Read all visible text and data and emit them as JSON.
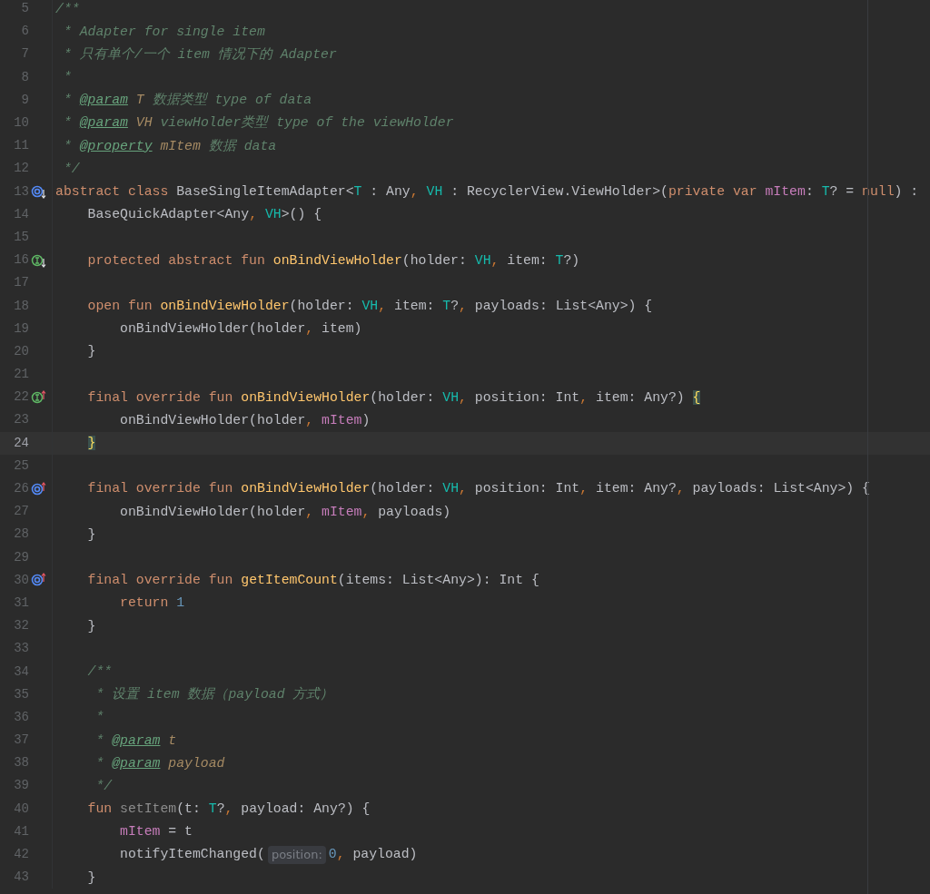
{
  "editor": {
    "lines": [
      {
        "no": "5",
        "current": false,
        "tokens": [
          {
            "text": "/**",
            "kind": "d"
          }
        ]
      },
      {
        "no": "6",
        "current": false,
        "tokens": [
          {
            "text": " * Adapter for single item",
            "kind": "d"
          }
        ]
      },
      {
        "no": "7",
        "current": false,
        "tokens": [
          {
            "text": " * 只有单个/一个 item 情况下的 Adapter",
            "kind": "d"
          }
        ]
      },
      {
        "no": "8",
        "current": false,
        "tokens": [
          {
            "text": " *",
            "kind": "d"
          }
        ]
      },
      {
        "no": "9",
        "current": false,
        "tokens": [
          {
            "text": " * ",
            "kind": "d"
          },
          {
            "text": "@param",
            "kind": "dt"
          },
          {
            "text": " T",
            "kind": "dp"
          },
          {
            "text": " 数据类型 type of data",
            "kind": "d"
          }
        ]
      },
      {
        "no": "10",
        "current": false,
        "tokens": [
          {
            "text": " * ",
            "kind": "d"
          },
          {
            "text": "@param",
            "kind": "dt"
          },
          {
            "text": " VH",
            "kind": "dp"
          },
          {
            "text": " viewHolder类型 type of the viewHolder",
            "kind": "d"
          }
        ]
      },
      {
        "no": "11",
        "current": false,
        "tokens": [
          {
            "text": " * ",
            "kind": "d"
          },
          {
            "text": "@property",
            "kind": "dt"
          },
          {
            "text": " mItem",
            "kind": "dp"
          },
          {
            "text": " 数据 data",
            "kind": "d"
          }
        ]
      },
      {
        "no": "12",
        "current": false,
        "tokens": [
          {
            "text": " */",
            "kind": "d"
          }
        ]
      },
      {
        "no": "13",
        "current": false,
        "gutter": {
          "kind": "ring-down"
        },
        "tokens": [
          {
            "text": "abstract class ",
            "kind": "k"
          },
          {
            "text": "BaseSingleItemAdapter<",
            "kind": "p"
          },
          {
            "text": "T",
            "kind": "ty"
          },
          {
            "text": " : Any",
            "kind": "p"
          },
          {
            "text": ", ",
            "kind": "c"
          },
          {
            "text": "VH",
            "kind": "ty"
          },
          {
            "text": " : RecyclerView.ViewHolder>(",
            "kind": "p"
          },
          {
            "text": "private var ",
            "kind": "k"
          },
          {
            "text": "mItem",
            "kind": "pr"
          },
          {
            "text": ": ",
            "kind": "p"
          },
          {
            "text": "T",
            "kind": "ty"
          },
          {
            "text": "? = ",
            "kind": "p"
          },
          {
            "text": "null",
            "kind": "k"
          },
          {
            "text": ") :",
            "kind": "p"
          }
        ]
      },
      {
        "no": "14",
        "current": false,
        "tokens": [
          {
            "text": "    BaseQuickAdapter<Any",
            "kind": "p"
          },
          {
            "text": ", ",
            "kind": "c"
          },
          {
            "text": "VH",
            "kind": "ty"
          },
          {
            "text": ">() {",
            "kind": "p"
          }
        ]
      },
      {
        "no": "15",
        "current": false
      },
      {
        "no": "16",
        "current": false,
        "gutter": {
          "kind": "i-down"
        },
        "tokens": [
          {
            "text": "    protected abstract fun ",
            "kind": "k"
          },
          {
            "text": "onBindViewHolder",
            "kind": "f"
          },
          {
            "text": "(holder: ",
            "kind": "p"
          },
          {
            "text": "VH",
            "kind": "ty"
          },
          {
            "text": ",",
            "kind": "c"
          },
          {
            "text": " item: ",
            "kind": "p"
          },
          {
            "text": "T",
            "kind": "ty"
          },
          {
            "text": "?)",
            "kind": "p"
          }
        ]
      },
      {
        "no": "17",
        "current": false
      },
      {
        "no": "18",
        "current": false,
        "tokens": [
          {
            "text": "    open fun ",
            "kind": "k"
          },
          {
            "text": "onBindViewHolder",
            "kind": "f"
          },
          {
            "text": "(holder: ",
            "kind": "p"
          },
          {
            "text": "VH",
            "kind": "ty"
          },
          {
            "text": ",",
            "kind": "c"
          },
          {
            "text": " item: ",
            "kind": "p"
          },
          {
            "text": "T",
            "kind": "ty"
          },
          {
            "text": "?",
            "kind": "p"
          },
          {
            "text": ",",
            "kind": "c"
          },
          {
            "text": " payloads: List<Any>) {",
            "kind": "p"
          }
        ]
      },
      {
        "no": "19",
        "current": false,
        "tokens": [
          {
            "text": "        onBindViewHolder(holder",
            "kind": "p"
          },
          {
            "text": ",",
            "kind": "c"
          },
          {
            "text": " item)",
            "kind": "p"
          }
        ]
      },
      {
        "no": "20",
        "current": false,
        "tokens": [
          {
            "text": "    }",
            "kind": "p"
          }
        ]
      },
      {
        "no": "21",
        "current": false
      },
      {
        "no": "22",
        "current": false,
        "gutter": {
          "kind": "i-up"
        },
        "tokens": [
          {
            "text": "    final override fun ",
            "kind": "k"
          },
          {
            "text": "onBindViewHolder",
            "kind": "f"
          },
          {
            "text": "(holder: ",
            "kind": "p"
          },
          {
            "text": "VH",
            "kind": "ty"
          },
          {
            "text": ",",
            "kind": "c"
          },
          {
            "text": " position: Int",
            "kind": "p"
          },
          {
            "text": ",",
            "kind": "c"
          },
          {
            "text": " item: Any?)",
            "kind": "p"
          },
          {
            "text": " {",
            "kind": "b"
          }
        ]
      },
      {
        "no": "23",
        "current": false,
        "tokens": [
          {
            "text": "        onBindViewHolder(holder",
            "kind": "p"
          },
          {
            "text": ", ",
            "kind": "c"
          },
          {
            "text": "mItem",
            "kind": "pr"
          },
          {
            "text": ")",
            "kind": "p"
          }
        ]
      },
      {
        "no": "24",
        "current": true,
        "tokens": [
          {
            "text": "    }",
            "kind": "b"
          }
        ]
      },
      {
        "no": "25",
        "current": false
      },
      {
        "no": "26",
        "current": false,
        "gutter": {
          "kind": "ring-up"
        },
        "tokens": [
          {
            "text": "    final override fun ",
            "kind": "k"
          },
          {
            "text": "onBindViewHolder",
            "kind": "f"
          },
          {
            "text": "(holder: ",
            "kind": "p"
          },
          {
            "text": "VH",
            "kind": "ty"
          },
          {
            "text": ",",
            "kind": "c"
          },
          {
            "text": " position: Int",
            "kind": "p"
          },
          {
            "text": ",",
            "kind": "c"
          },
          {
            "text": " item: Any?",
            "kind": "p"
          },
          {
            "text": ",",
            "kind": "c"
          },
          {
            "text": " payloads: List<Any>) {",
            "kind": "p"
          }
        ]
      },
      {
        "no": "27",
        "current": false,
        "tokens": [
          {
            "text": "        onBindViewHolder(holder",
            "kind": "p"
          },
          {
            "text": ", ",
            "kind": "c"
          },
          {
            "text": "mItem",
            "kind": "pr"
          },
          {
            "text": ",",
            "kind": "c"
          },
          {
            "text": " payloads)",
            "kind": "p"
          }
        ]
      },
      {
        "no": "28",
        "current": false,
        "tokens": [
          {
            "text": "    }",
            "kind": "p"
          }
        ]
      },
      {
        "no": "29",
        "current": false
      },
      {
        "no": "30",
        "current": false,
        "gutter": {
          "kind": "ring-up"
        },
        "tokens": [
          {
            "text": "    final override fun ",
            "kind": "k"
          },
          {
            "text": "getItemCount",
            "kind": "f"
          },
          {
            "text": "(items: List<Any>): Int {",
            "kind": "p"
          }
        ]
      },
      {
        "no": "31",
        "current": false,
        "tokens": [
          {
            "text": "        return ",
            "kind": "k"
          },
          {
            "text": "1",
            "kind": "n"
          }
        ]
      },
      {
        "no": "32",
        "current": false,
        "tokens": [
          {
            "text": "    }",
            "kind": "p"
          }
        ]
      },
      {
        "no": "33",
        "current": false
      },
      {
        "no": "34",
        "current": false,
        "tokens": [
          {
            "text": "    /**",
            "kind": "d"
          }
        ]
      },
      {
        "no": "35",
        "current": false,
        "tokens": [
          {
            "text": "     * 设置 item 数据（payload 方式）",
            "kind": "d"
          }
        ]
      },
      {
        "no": "36",
        "current": false,
        "tokens": [
          {
            "text": "     *",
            "kind": "d"
          }
        ]
      },
      {
        "no": "37",
        "current": false,
        "tokens": [
          {
            "text": "     * ",
            "kind": "d"
          },
          {
            "text": "@param",
            "kind": "dt"
          },
          {
            "text": " t",
            "kind": "dp"
          }
        ]
      },
      {
        "no": "38",
        "current": false,
        "tokens": [
          {
            "text": "     * ",
            "kind": "d"
          },
          {
            "text": "@param",
            "kind": "dt"
          },
          {
            "text": " payload",
            "kind": "dp"
          }
        ]
      },
      {
        "no": "39",
        "current": false,
        "tokens": [
          {
            "text": "     */",
            "kind": "d"
          }
        ]
      },
      {
        "no": "40",
        "current": false,
        "tokens": [
          {
            "text": "    fun ",
            "kind": "k"
          },
          {
            "text": "setItem",
            "kind": "u"
          },
          {
            "text": "(t: ",
            "kind": "p"
          },
          {
            "text": "T",
            "kind": "ty"
          },
          {
            "text": "?",
            "kind": "p"
          },
          {
            "text": ",",
            "kind": "c"
          },
          {
            "text": " payload: Any?) {",
            "kind": "p"
          }
        ]
      },
      {
        "no": "41",
        "current": false,
        "tokens": [
          {
            "text": "        mItem",
            "kind": "pr"
          },
          {
            "text": " = t",
            "kind": "p"
          }
        ]
      },
      {
        "no": "42",
        "current": false,
        "tokens": [
          {
            "text": "        notifyItemChanged(",
            "kind": "p"
          },
          {
            "text": "position:",
            "kind": "h"
          },
          {
            "text": "0",
            "kind": "n"
          },
          {
            "text": ",",
            "kind": "c"
          },
          {
            "text": " payload)",
            "kind": "p"
          }
        ]
      },
      {
        "no": "43",
        "current": false,
        "tokens": [
          {
            "text": "    }",
            "kind": "p"
          }
        ]
      }
    ]
  }
}
